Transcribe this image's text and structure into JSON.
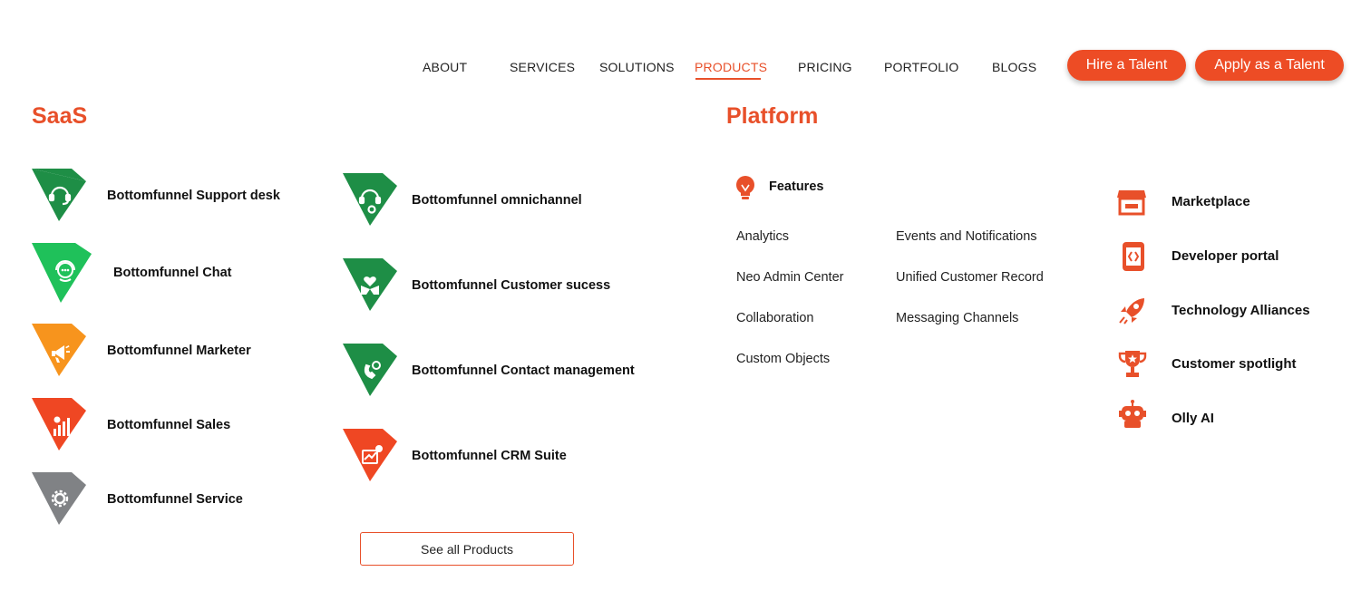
{
  "nav": {
    "items": [
      {
        "label": "ABOUT"
      },
      {
        "label": "SERVICES"
      },
      {
        "label": "SOLUTIONS"
      },
      {
        "label": "PRODUCTS",
        "active": true
      },
      {
        "label": "PRICING"
      },
      {
        "label": "PORTFOLIO"
      },
      {
        "label": "BLOGS"
      }
    ],
    "hire_label": "Hire a Talent",
    "apply_label": "Apply as a Talent"
  },
  "saas": {
    "title": "SaaS",
    "left_column": [
      {
        "label": "Bottomfunnel Support desk",
        "icon": "headset-icon",
        "color": "#1e8e46"
      },
      {
        "label": "Bottomfunnel Chat",
        "icon": "chat-support-icon",
        "color": "#1fc15a"
      },
      {
        "label": "Bottomfunnel Marketer",
        "icon": "megaphone-icon",
        "color": "#f7941d"
      },
      {
        "label": "Bottomfunnel Sales",
        "icon": "sales-chart-icon",
        "color": "#ef4723"
      },
      {
        "label": "Bottomfunnel Service",
        "icon": "gears-icon",
        "color": "#808285"
      }
    ],
    "right_column": [
      {
        "label": "Bottomfunnel omnichannel",
        "icon": "headset-plus-icon",
        "color": "#1e8e46"
      },
      {
        "label": "Bottomfunnel Customer sucess",
        "icon": "hands-heart-icon",
        "color": "#1e8e46"
      },
      {
        "label": "Bottomfunnel Contact management",
        "icon": "phone-contact-icon",
        "color": "#1e8e46"
      },
      {
        "label": "Bottomfunnel CRM Suite",
        "icon": "crm-suite-icon",
        "color": "#ef4723"
      }
    ],
    "see_all_label": "See all Products"
  },
  "platform": {
    "title": "Platform",
    "features_heading": "Features",
    "features_col1": [
      "Analytics",
      "Neo Admin Center",
      "Collaboration",
      "Custom Objects"
    ],
    "features_col2": [
      "Events and Notifications",
      "Unified Customer Record",
      "Messaging Channels"
    ],
    "items": [
      {
        "label": "Marketplace",
        "icon": "storefront-icon"
      },
      {
        "label": "Developer portal",
        "icon": "code-phone-icon"
      },
      {
        "label": "Technology Alliances",
        "icon": "rocket-icon"
      },
      {
        "label": "Customer spotlight",
        "icon": "trophy-icon"
      },
      {
        "label": "Olly AI",
        "icon": "robot-icon"
      }
    ]
  },
  "colors": {
    "accent": "#e8502a",
    "button": "#ed4c25",
    "green": "#1e8e46",
    "light_green": "#1fc15a",
    "orange": "#f7941d",
    "red": "#ef4723",
    "gray": "#808285"
  }
}
